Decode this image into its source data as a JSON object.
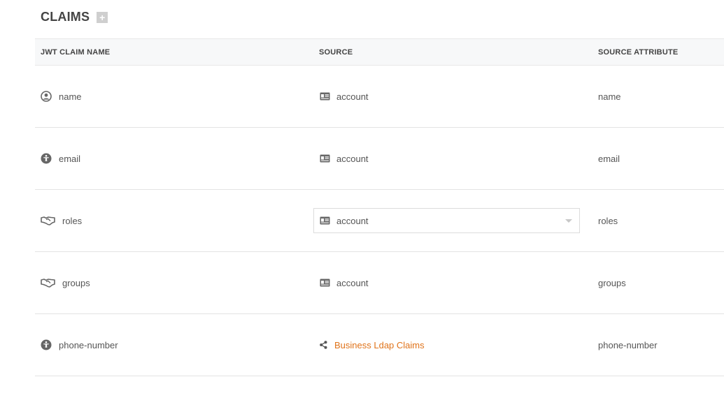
{
  "section": {
    "title": "CLAIMS",
    "add_label": "+"
  },
  "table": {
    "headers": [
      "JWT CLAIM NAME",
      "SOURCE",
      "SOURCE ATTRIBUTE"
    ],
    "rows": [
      {
        "claim": "name",
        "claim_icon": "user-circle-icon",
        "source": "account",
        "source_icon": "id-card-icon",
        "attribute": "name"
      },
      {
        "claim": "email",
        "claim_icon": "accessibility-icon",
        "source": "account",
        "source_icon": "id-card-icon",
        "attribute": "email"
      },
      {
        "claim": "roles",
        "claim_icon": "handshake-icon",
        "source": "account",
        "source_icon": "id-card-icon",
        "attribute": "roles",
        "source_is_select": true
      },
      {
        "claim": "groups",
        "claim_icon": "handshake-icon",
        "source": "account",
        "source_icon": "id-card-icon",
        "attribute": "groups"
      },
      {
        "claim": "phone-number",
        "claim_icon": "accessibility-icon",
        "source": "Business Ldap Claims",
        "source_icon": "share-icon",
        "attribute": "phone-number",
        "source_is_link": true
      }
    ]
  },
  "colors": {
    "link": "#e0731a",
    "header_bg": "#f7f8f9",
    "text": "#555555"
  }
}
